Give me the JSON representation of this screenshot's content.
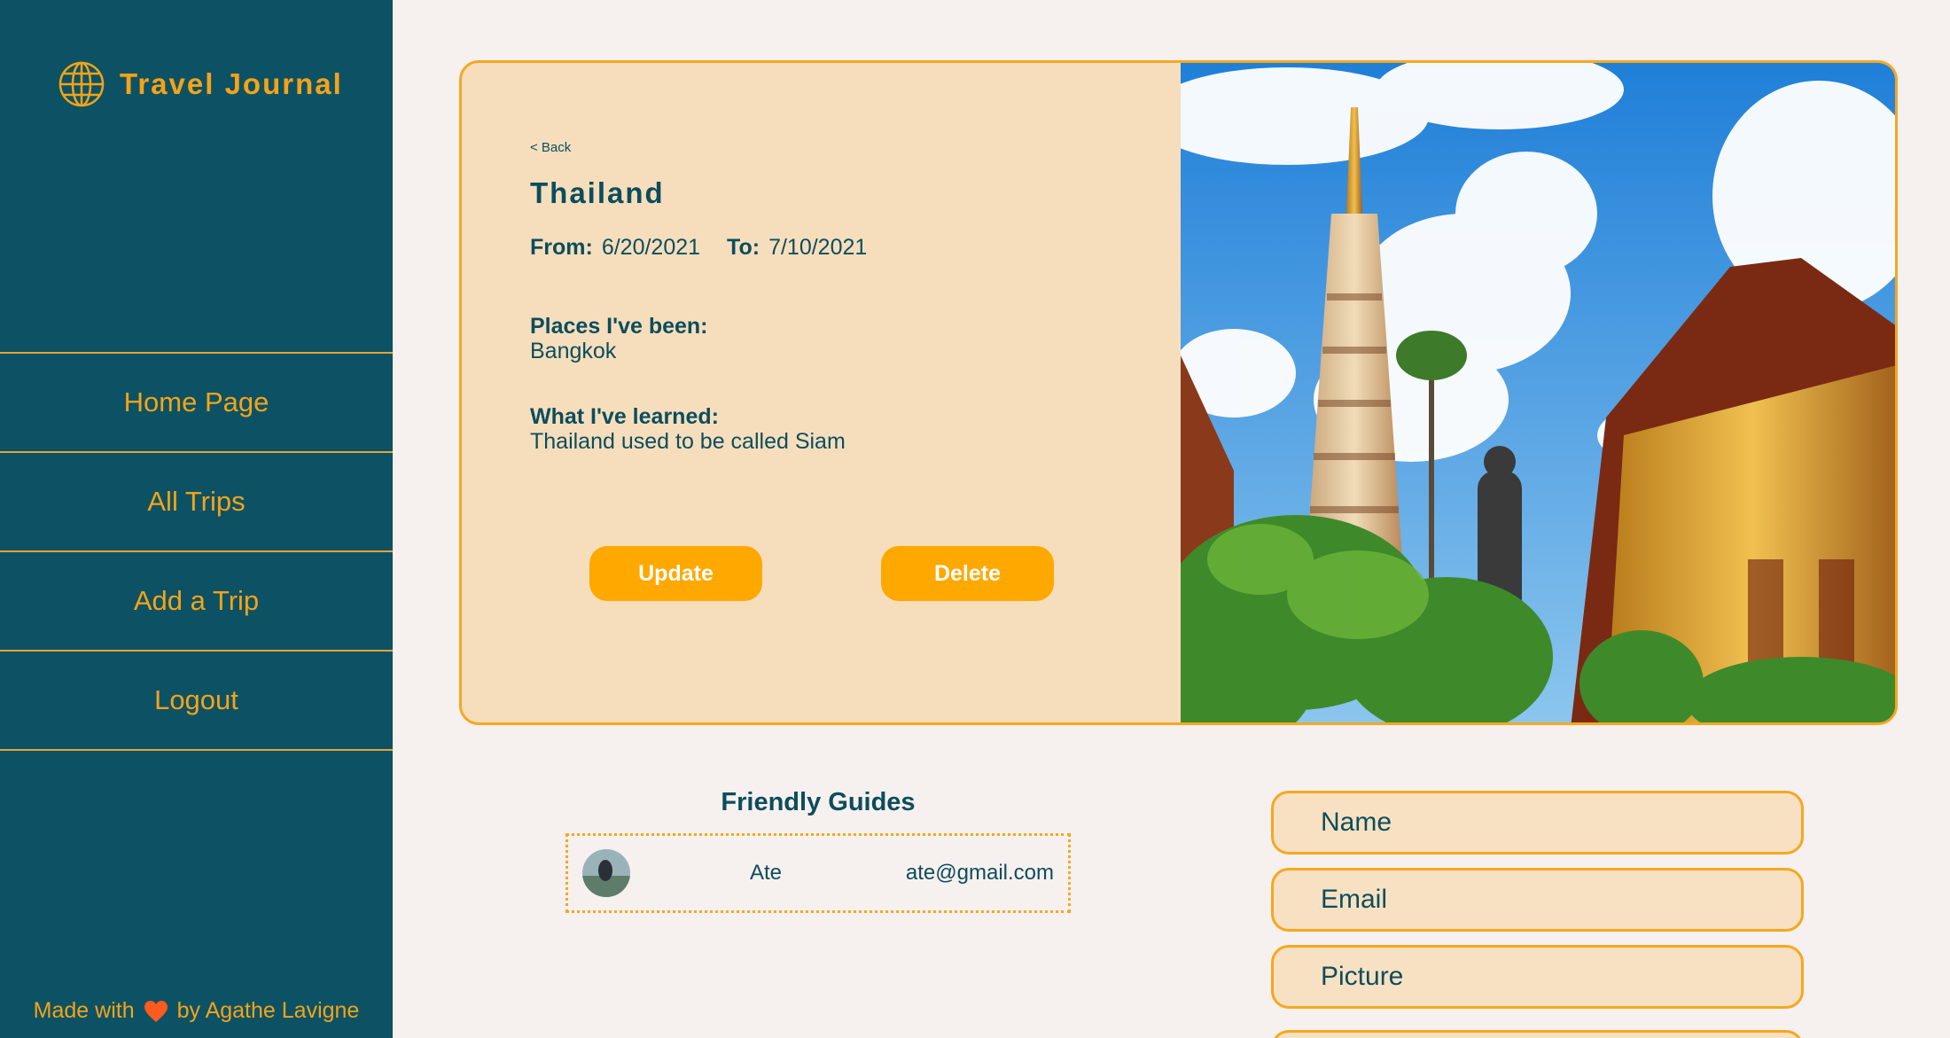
{
  "app": {
    "title": "Travel Journal"
  },
  "sidebar": {
    "items": [
      {
        "label": "Home Page"
      },
      {
        "label": "All Trips"
      },
      {
        "label": "Add a Trip"
      },
      {
        "label": "Logout"
      }
    ],
    "footer": {
      "prefix": "Made with",
      "suffix": "by Agathe Lavigne",
      "icon": "heart-icon"
    }
  },
  "trip": {
    "back": "< Back",
    "name": "Thailand",
    "from_label": "From:",
    "from": "6/20/2021",
    "to_label": "To:",
    "to": "7/10/2021",
    "places_label": "Places I've been:",
    "places": "Bangkok",
    "learned_label": "What I've learned:",
    "learned": "Thailand used to be called Siam",
    "update_label": "Update",
    "delete_label": "Delete"
  },
  "guides": {
    "title": "Friendly Guides",
    "items": [
      {
        "name": "Ate",
        "email": "ate@gmail.com"
      }
    ]
  },
  "form": {
    "name_placeholder": "Name",
    "email_placeholder": "Email",
    "picture_placeholder": "Picture"
  },
  "colors": {
    "sidebar": "#0c5264",
    "accent": "#f5a318",
    "card": "#f6debd",
    "background": "#f6f0ef"
  }
}
